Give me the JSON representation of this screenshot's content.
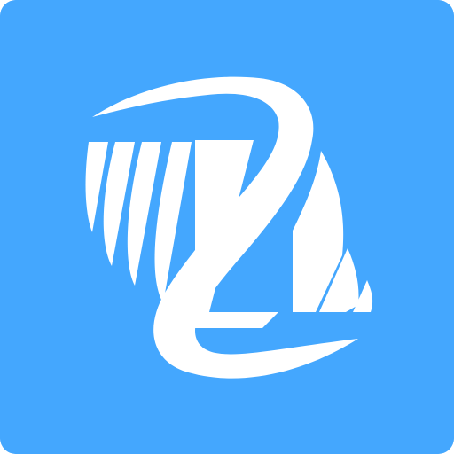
{
  "icon": {
    "name": "app-logo-icon",
    "background_color": "#44a7fe",
    "foreground_color": "#ffffff"
  }
}
